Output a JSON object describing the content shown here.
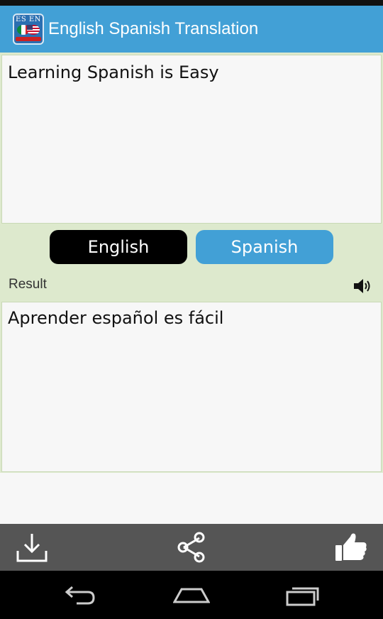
{
  "app_bar": {
    "title": "English Spanish Translation",
    "icon_text": "ES EN",
    "background": "#42a0d6"
  },
  "input": {
    "text": "Learning Spanish is Easy"
  },
  "languages": {
    "source_label": "English",
    "target_label": "Spanish",
    "source_color": "#000000",
    "target_color": "#42a0d6"
  },
  "result": {
    "label": "Result",
    "text": "Aprender español es fácil"
  },
  "toolbar": {
    "icons": [
      "download-icon",
      "share-icon",
      "thumbs-up-icon"
    ]
  },
  "nav": {
    "icons": [
      "back-icon",
      "home-icon",
      "recent-apps-icon"
    ]
  }
}
